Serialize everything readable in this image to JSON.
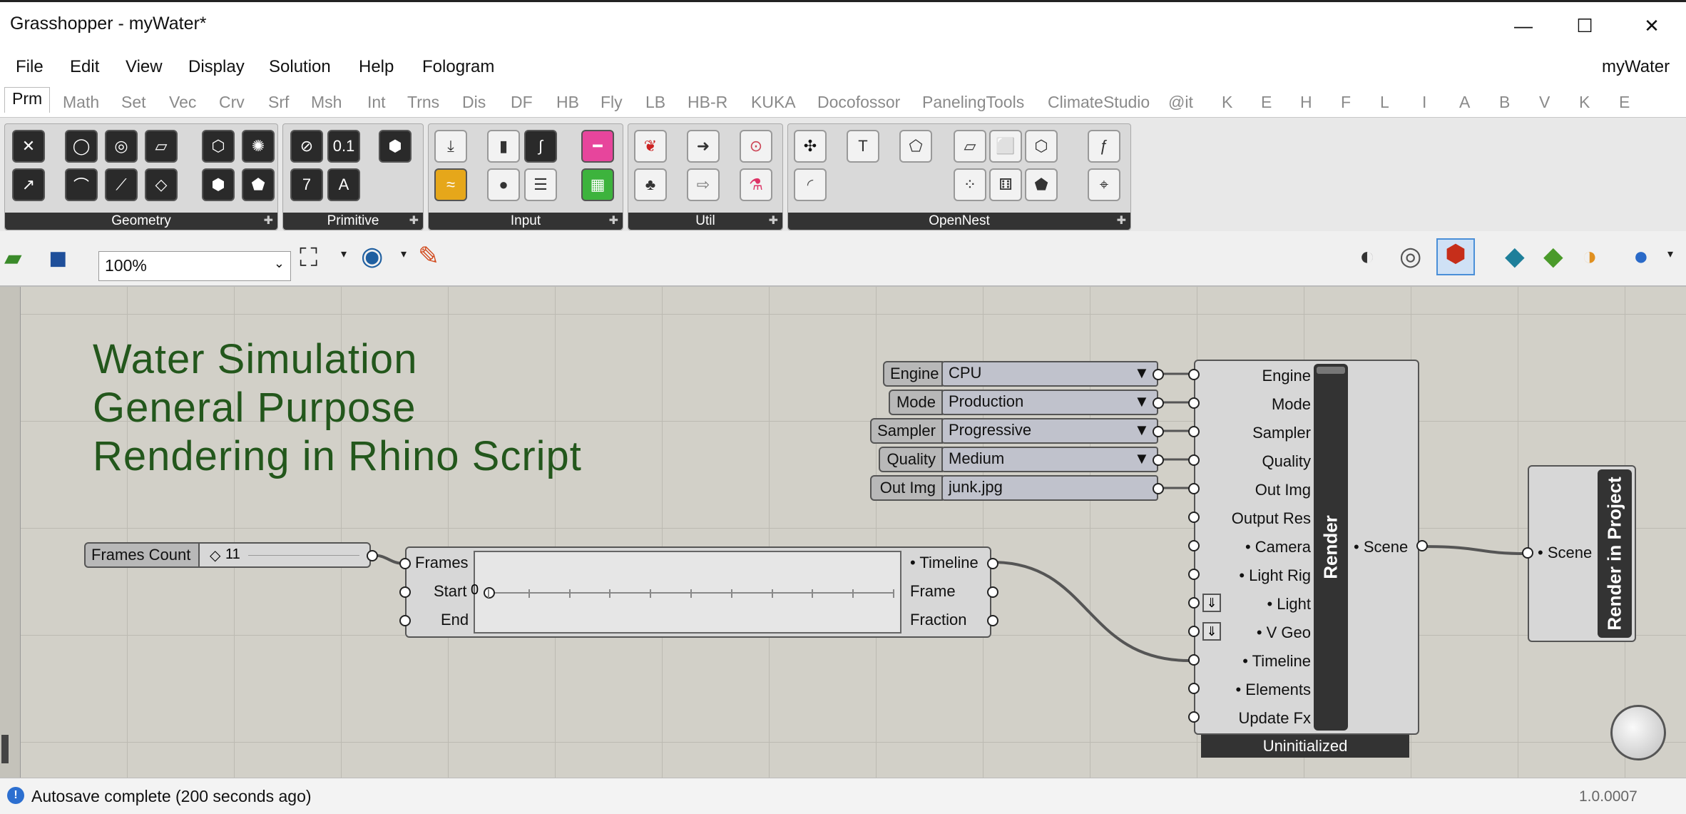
{
  "window": {
    "title": "Grasshopper - myWater*",
    "doc_name": "myWater",
    "minimize": "—",
    "maximize": "☐",
    "close": "✕"
  },
  "menu": [
    "File",
    "Edit",
    "View",
    "Display",
    "Solution",
    "Help",
    "Fologram"
  ],
  "tabs": [
    "Prm",
    "Math",
    "Set",
    "Vec",
    "Crv",
    "Srf",
    "Msh",
    "Int",
    "Trns",
    "Dis",
    "DF",
    "HB",
    "Fly",
    "LB",
    "HB-R",
    "KUKA",
    "Docofossor",
    "PanelingTools",
    "ClimateStudio",
    "@it",
    "K",
    "E",
    "H",
    "F",
    "L",
    "I",
    "A",
    "B",
    "V",
    "K",
    "E"
  ],
  "ribbon_panels": [
    "Geometry",
    "Primitive",
    "Input",
    "Util",
    "OpenNest"
  ],
  "toolbar": {
    "zoom": "100%"
  },
  "canvas": {
    "title_lines": [
      "Water Simulation",
      "General Purpose",
      "Rendering in Rhino Script"
    ],
    "selectors": [
      {
        "name": "Engine",
        "value": "CPU"
      },
      {
        "name": "Mode",
        "value": "Production"
      },
      {
        "name": "Sampler",
        "value": "Progressive"
      },
      {
        "name": "Quality",
        "value": "Medium"
      }
    ],
    "out_img": {
      "name": "Out Img",
      "value": "junk.jpg"
    },
    "frames_slider": {
      "name": "Frames Count",
      "value": "11"
    },
    "timeline": {
      "inputs": [
        "Frames",
        "Start",
        "End"
      ],
      "outputs": [
        "• Timeline",
        "Frame",
        "Fraction"
      ],
      "start_value": "0",
      "start_fraction": 0
    },
    "render": {
      "name": "Render",
      "inputs": [
        "Engine",
        "Mode",
        "Sampler",
        "Quality",
        "Out Img",
        "Output Res",
        "• Camera",
        "• Light Rig",
        "• Light",
        "• V Geo",
        "• Timeline",
        "• Elements",
        "Update Fx"
      ],
      "output": "• Scene",
      "status": "Uninitialized"
    },
    "render_project": {
      "name": "Render in Project",
      "input": "• Scene"
    }
  },
  "status": {
    "message": "Autosave complete (200 seconds ago)",
    "version": "1.0.0007"
  },
  "colors": {
    "title_text": "#23571c",
    "canvas": "#d2d0c8",
    "wire": "#555555"
  }
}
